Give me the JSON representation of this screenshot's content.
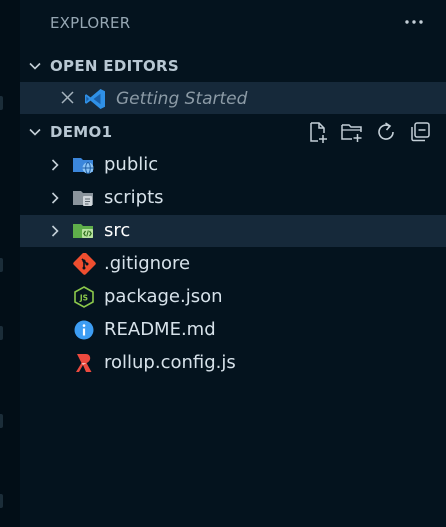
{
  "explorer": {
    "title": "EXPLORER",
    "more_icon": "ellipsis-icon"
  },
  "open_editors": {
    "title": "OPEN EDITORS",
    "items": [
      {
        "label": "Getting Started",
        "icon": "vscode-icon"
      }
    ]
  },
  "workspace": {
    "title": "DEMO1",
    "actions": [
      {
        "name": "new-file-icon"
      },
      {
        "name": "new-folder-icon"
      },
      {
        "name": "refresh-icon"
      },
      {
        "name": "collapse-all-icon"
      }
    ],
    "tree": [
      {
        "label": "public",
        "type": "folder",
        "icon": "folder-public-icon",
        "expanded": false
      },
      {
        "label": "scripts",
        "type": "folder",
        "icon": "folder-scripts-icon",
        "expanded": false
      },
      {
        "label": "src",
        "type": "folder",
        "icon": "folder-src-icon",
        "expanded": false,
        "selected": true
      },
      {
        "label": ".gitignore",
        "type": "file",
        "icon": "git-icon"
      },
      {
        "label": "package.json",
        "type": "file",
        "icon": "nodejs-icon"
      },
      {
        "label": "README.md",
        "type": "file",
        "icon": "info-icon"
      },
      {
        "label": "rollup.config.js",
        "type": "file",
        "icon": "rollup-icon"
      }
    ]
  },
  "colors": {
    "background": "#04131e",
    "selected_row": "#16293a",
    "text": "#d7e2ea",
    "muted_text": "#96a7b3",
    "vscode_blue": "#2f90e6",
    "folder_blue": "#3b86db",
    "folder_grey": "#8a949c",
    "folder_green": "#5fae4a",
    "git_orange": "#ef4e2f",
    "node_green": "#8cc84b",
    "info_blue": "#3d9df3",
    "rollup_red": "#ec4a3f"
  }
}
